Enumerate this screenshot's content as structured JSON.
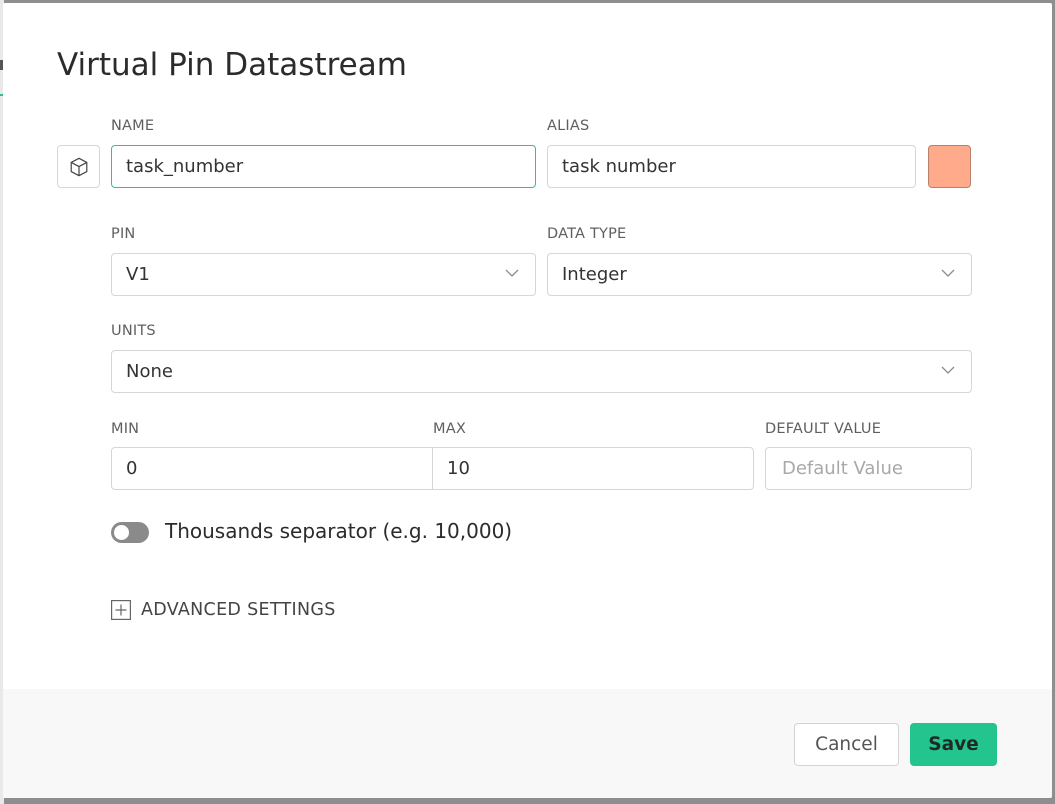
{
  "dialog": {
    "title": "Virtual Pin Datastream"
  },
  "fields": {
    "name": {
      "label": "NAME",
      "value": "task_number"
    },
    "alias": {
      "label": "ALIAS",
      "value": "task number"
    },
    "color": "#FFAA8A",
    "pin": {
      "label": "PIN",
      "value": "V1"
    },
    "data_type": {
      "label": "DATA TYPE",
      "value": "Integer"
    },
    "units": {
      "label": "UNITS",
      "value": "None"
    },
    "min": {
      "label": "MIN",
      "value": "0"
    },
    "max": {
      "label": "MAX",
      "value": "10"
    },
    "default_value": {
      "label": "DEFAULT VALUE",
      "value": "",
      "placeholder": "Default Value"
    }
  },
  "thousands_separator": {
    "label": "Thousands separator (e.g. 10,000)",
    "enabled": false
  },
  "advanced_settings": {
    "label": "ADVANCED SETTINGS",
    "icon": "plus-square-icon"
  },
  "icons": {
    "datastream": "cube-icon",
    "dropdown": "chevron-down-icon"
  },
  "buttons": {
    "cancel": "Cancel",
    "save": "Save"
  },
  "colors": {
    "accent": "#23C48E",
    "focus_border": "#33C18F"
  }
}
